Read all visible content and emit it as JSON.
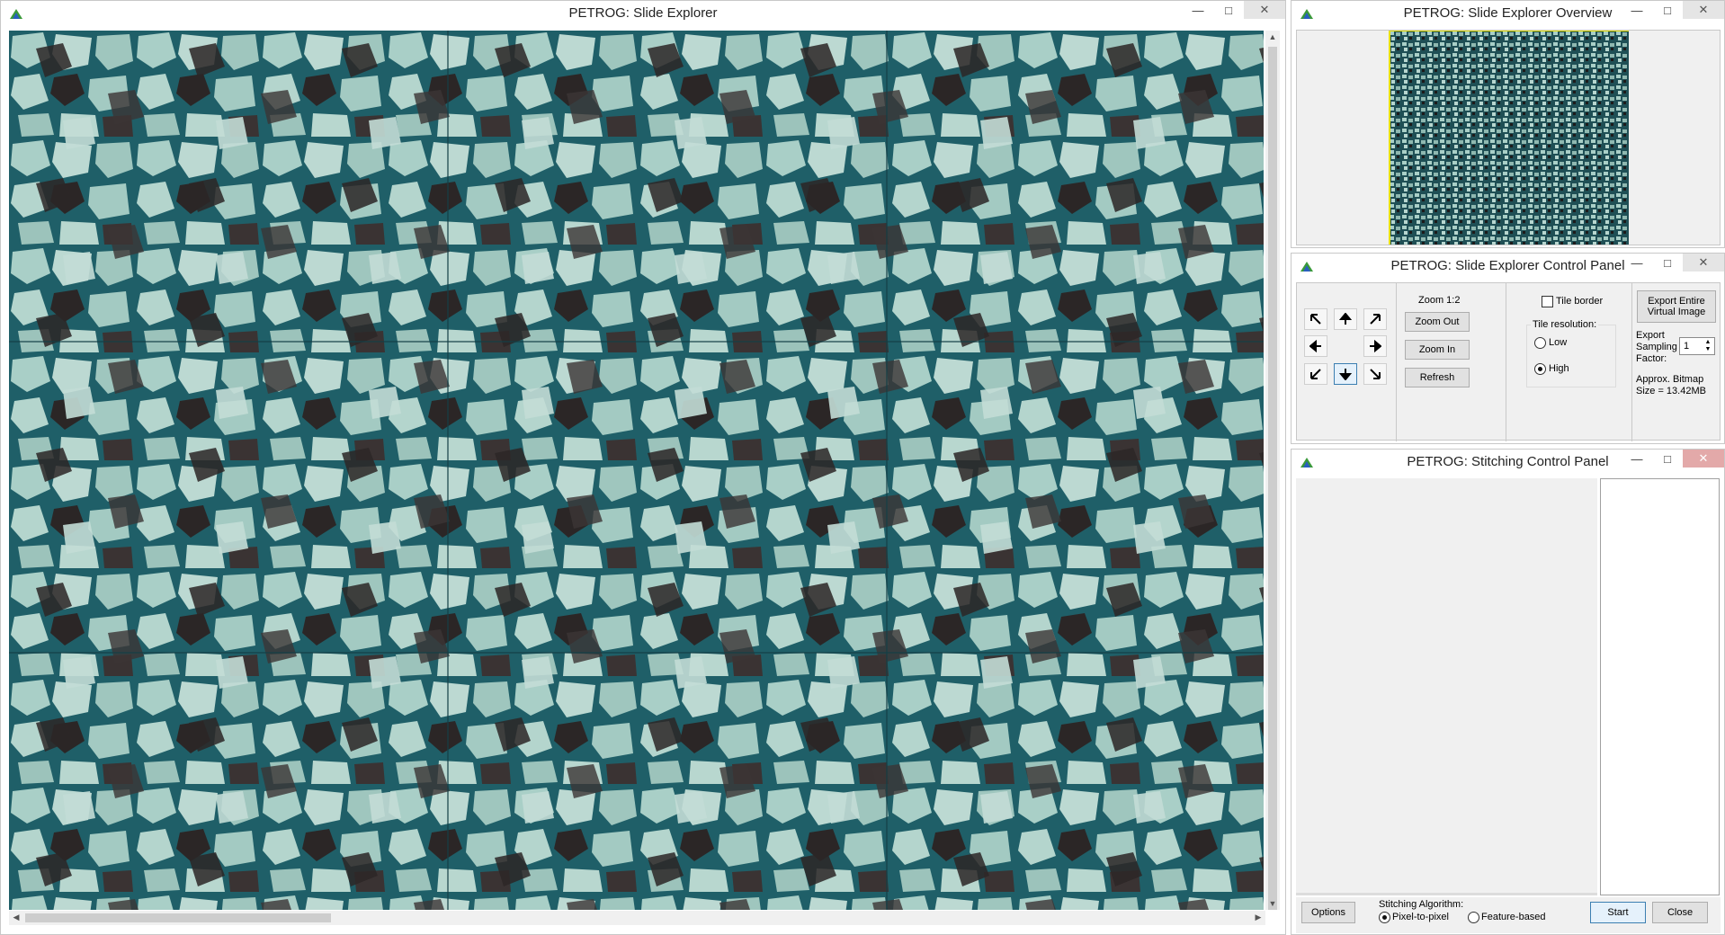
{
  "slide_explorer": {
    "title": "PETROG: Slide Explorer"
  },
  "overview": {
    "title": "PETROG: Slide Explorer Overview"
  },
  "control_panel": {
    "title": "PETROG: Slide Explorer Control Panel",
    "zoom_label": "Zoom 1:2",
    "zoom_out": "Zoom Out",
    "zoom_in": "Zoom In",
    "refresh": "Refresh",
    "tile_border": "Tile border",
    "tile_border_checked": false,
    "tile_resolution": "Tile resolution:",
    "res_low": "Low",
    "res_high": "High",
    "res_selected": "High",
    "export_button": "Export Entire Virtual Image",
    "export_sampling": "Export Sampling Factor:",
    "sampling_value": "1",
    "bitmap_size": "Approx. Bitmap Size = 13.42MB"
  },
  "stitching": {
    "title": "PETROG: Stitching Control Panel",
    "options": "Options",
    "algorithm_label": "Stitching Algorithm:",
    "algo_pixel": "Pixel-to-pixel",
    "algo_feature": "Feature-based",
    "algo_selected": "Pixel-to-pixel",
    "start": "Start",
    "close": "Close"
  },
  "colors": {
    "pore_blue": "#1f5f68",
    "grain_light": "#a9cfc7",
    "grain_dark": "#2b2626",
    "accent": "#3c7fb1"
  }
}
